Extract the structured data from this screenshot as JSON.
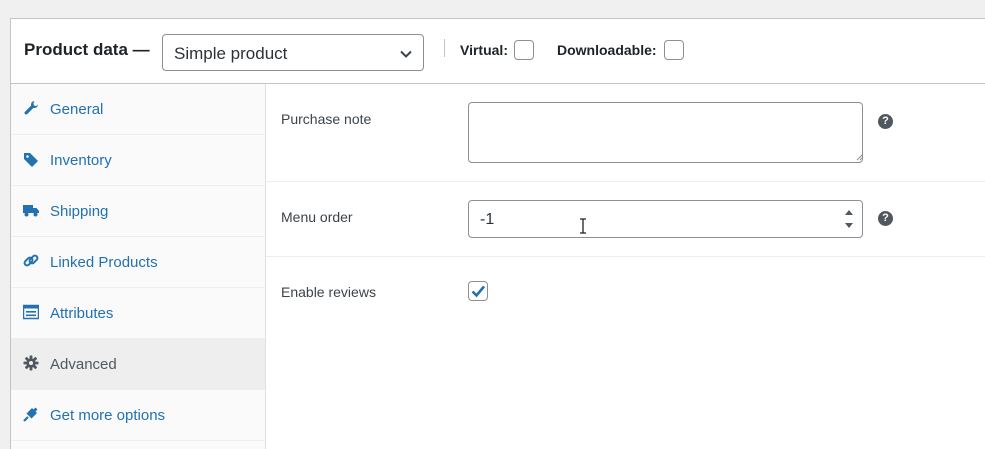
{
  "header": {
    "title": "Product data —",
    "product_type": "Simple product",
    "virtual_label": "Virtual:",
    "downloadable_label": "Downloadable:",
    "virtual_checked": false,
    "downloadable_checked": false
  },
  "tabs": [
    {
      "label": "General",
      "icon": "wrench-icon",
      "active": false
    },
    {
      "label": "Inventory",
      "icon": "tag-icon",
      "active": false
    },
    {
      "label": "Shipping",
      "icon": "truck-icon",
      "active": false
    },
    {
      "label": "Linked Products",
      "icon": "link-icon",
      "active": false
    },
    {
      "label": "Attributes",
      "icon": "list-view-icon",
      "active": false
    },
    {
      "label": "Advanced",
      "icon": "gear-icon",
      "active": true
    },
    {
      "label": "Get more options",
      "icon": "plugin-icon",
      "active": false
    }
  ],
  "fields": {
    "purchase_note": {
      "label": "Purchase note",
      "value": ""
    },
    "menu_order": {
      "label": "Menu order",
      "value": "-1"
    },
    "enable_reviews": {
      "label": "Enable reviews",
      "checked": true
    },
    "help_glyph": "?"
  },
  "colors": {
    "link": "#2271b1",
    "active_tab_bg": "#eee",
    "border": "#c3c4c7",
    "check": "#2271b1"
  }
}
